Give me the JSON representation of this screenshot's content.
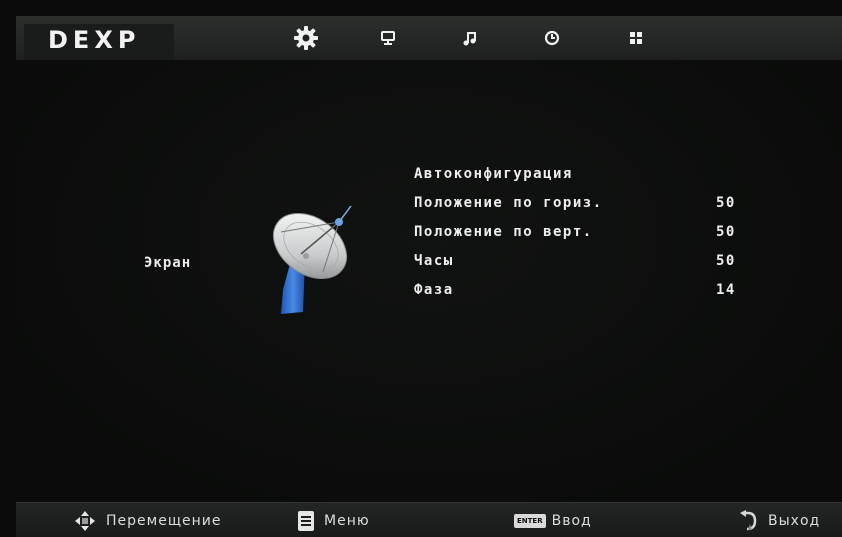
{
  "header": {
    "logo": "DEXP",
    "tabs": [
      {
        "icon": "gear-icon",
        "active": true
      },
      {
        "icon": "monitor-icon",
        "active": false
      },
      {
        "icon": "music-note-icon",
        "active": false
      },
      {
        "icon": "clock-icon",
        "active": false
      },
      {
        "icon": "grid-icon",
        "active": false
      }
    ]
  },
  "main": {
    "section_title": "Экран",
    "section_icon": "satellite-dish-icon",
    "items": [
      {
        "label": "Автоконфигурация",
        "value": ""
      },
      {
        "label": "Положение по гориз.",
        "value": "50"
      },
      {
        "label": "Положение по верт.",
        "value": "50"
      },
      {
        "label": "Часы",
        "value": "50"
      },
      {
        "label": "Фаза",
        "value": "14"
      }
    ]
  },
  "footer": {
    "move": {
      "label": "Перемещение",
      "icon": "dpad-icon"
    },
    "menu": {
      "label": "Меню",
      "icon": "menu-doc-icon"
    },
    "enter": {
      "key": "ENTER",
      "label": "Ввод",
      "icon": "enter-key-icon"
    },
    "exit": {
      "label": "Выход",
      "icon": "return-arrow-icon"
    }
  },
  "colors": {
    "background": "#0b0b0b",
    "bar": "#232624",
    "text": "#eeeeee",
    "dish_blue": "#2f6fd0"
  }
}
